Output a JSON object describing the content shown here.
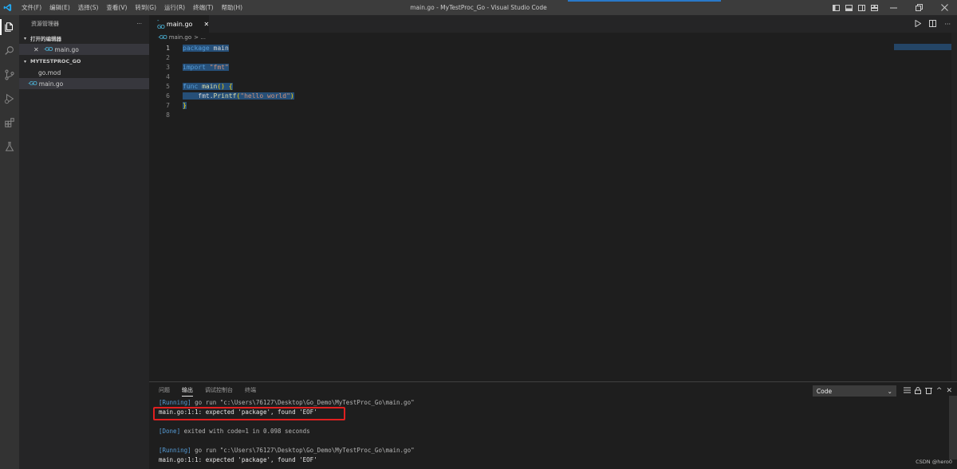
{
  "window": {
    "title": "main.go - MyTestProc_Go - Visual Studio Code",
    "menu": [
      "文件(F)",
      "编辑(E)",
      "选择(S)",
      "查看(V)",
      "转到(G)",
      "运行(R)",
      "终端(T)",
      "帮助(H)"
    ]
  },
  "sidebar": {
    "header": "资源管理器",
    "more": "···",
    "open_editors_label": "打开的编辑器",
    "open_editors": [
      {
        "name": "main.go"
      }
    ],
    "workspace_label": "MYTESTPROC_GO",
    "files": [
      {
        "name": "go.mod"
      },
      {
        "name": "main.go"
      }
    ]
  },
  "editor": {
    "tab_label": "main.go",
    "breadcrumb_file": "main.go",
    "breadcrumb_sep": "> ...",
    "lines": [
      {
        "n": "1"
      },
      {
        "n": "2"
      },
      {
        "n": "3"
      },
      {
        "n": "4"
      },
      {
        "n": "5"
      },
      {
        "n": "6"
      },
      {
        "n": "7"
      },
      {
        "n": "8"
      }
    ],
    "code": {
      "l1_kw": "package",
      "l1_rest": " main",
      "l3_kw": "import",
      "l3_str": " \"fmt\"",
      "l5_kw": "func",
      "l5_fn": " main",
      "l5_rest": "() {",
      "l6_pre": "    fmt.",
      "l6_fn": "Printf",
      "l6_open": "(",
      "l6_str": "\"hello world\"",
      "l6_close": ")",
      "l7": "}"
    }
  },
  "panel": {
    "tabs": [
      "问题",
      "输出",
      "调试控制台",
      "终端"
    ],
    "active_tab": "输出",
    "channel": "Code",
    "output": {
      "run1_tag": "[Running]",
      "run1_cmd": " go run \"c:\\Users\\76127\\Desktop\\Go_Demo\\MyTestProc_Go\\main.go\"",
      "err1": "main.go:1:1: expected 'package', found 'EOF'",
      "done_tag": "[Done]",
      "done_text": " exited with code=1 in 0.098 seconds",
      "run2_tag": "[Running]",
      "run2_cmd": " go run \"c:\\Users\\76127\\Desktop\\Go_Demo\\MyTestProc_Go\\main.go\"",
      "err2": "main.go:1:1: expected 'package', found 'EOF'"
    }
  },
  "watermark": "CSDN @hero0",
  "colors": {
    "accent": "#007acc",
    "error_box": "#e02020",
    "keyword": "#569cd6",
    "string": "#ce9178",
    "function": "#dcdcaa"
  }
}
